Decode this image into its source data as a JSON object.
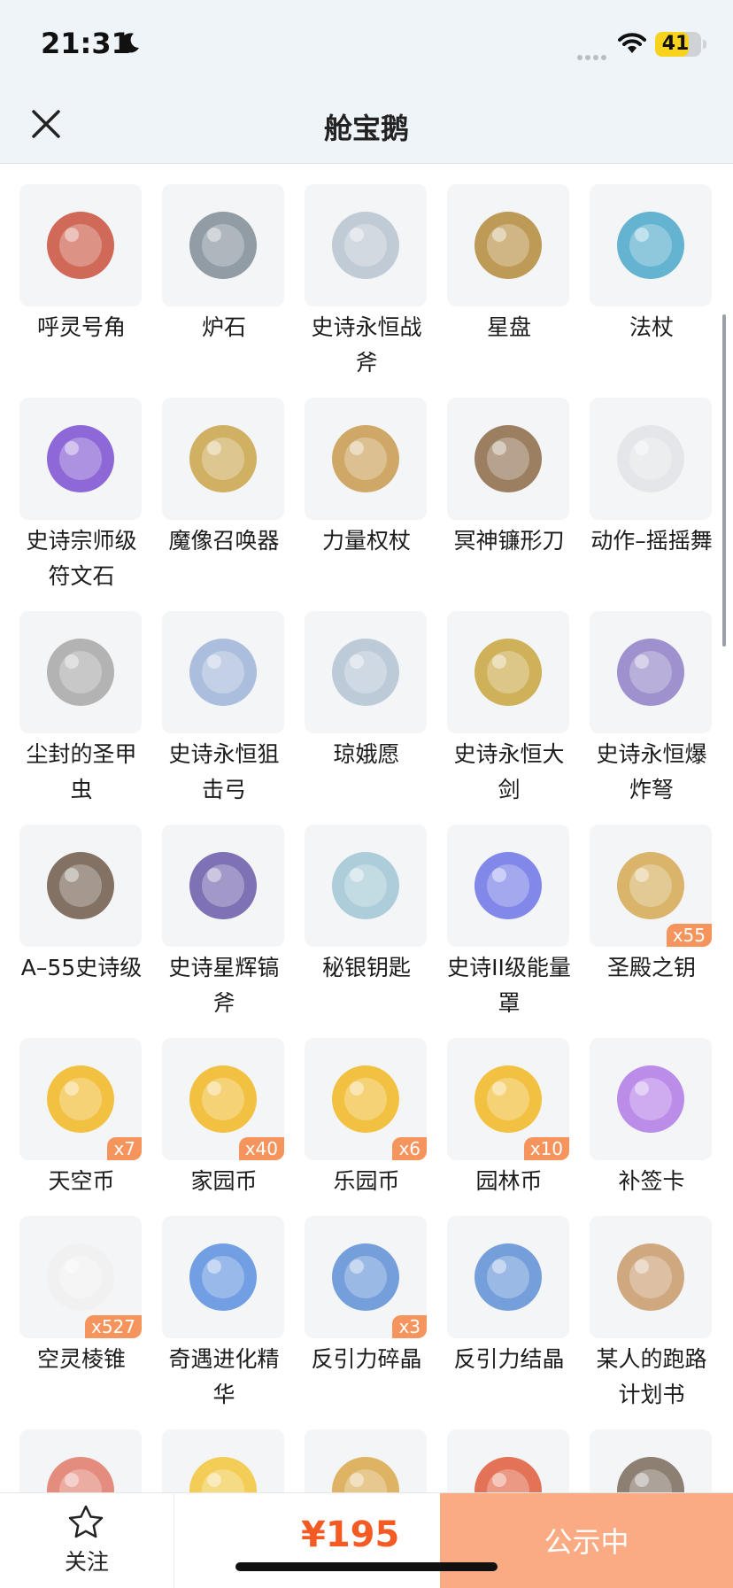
{
  "status_bar": {
    "time": "21:31",
    "battery": "41"
  },
  "header": {
    "title": "舱宝鹅"
  },
  "icons": {
    "close": "close-icon",
    "moon": "moon-icon",
    "wifi": "wifi-icon",
    "star": "star-icon"
  },
  "colors": {
    "accent": "#f45a24",
    "badge": "#f6945d",
    "action_button": "#fbab83",
    "header_bg": "#eef4f8",
    "tile_bg": "#f4f5f7"
  },
  "items": [
    {
      "label": "呼灵号角",
      "badge": ""
    },
    {
      "label": "炉石",
      "badge": ""
    },
    {
      "label": "史诗永恒战斧",
      "badge": ""
    },
    {
      "label": "星盘",
      "badge": ""
    },
    {
      "label": "法杖",
      "badge": ""
    },
    {
      "label": "史诗宗师级符文石",
      "badge": ""
    },
    {
      "label": "魔像召唤器",
      "badge": ""
    },
    {
      "label": "力量权杖",
      "badge": ""
    },
    {
      "label": "冥神镰形刀",
      "badge": ""
    },
    {
      "label": "动作–摇摇舞",
      "badge": ""
    },
    {
      "label": "尘封的圣甲虫",
      "badge": ""
    },
    {
      "label": "史诗永恒狙击弓",
      "badge": ""
    },
    {
      "label": "琼娥愿",
      "badge": ""
    },
    {
      "label": "史诗永恒大剑",
      "badge": ""
    },
    {
      "label": "史诗永恒爆炸弩",
      "badge": ""
    },
    {
      "label": "A–55史诗级",
      "badge": ""
    },
    {
      "label": "史诗星辉镐斧",
      "badge": ""
    },
    {
      "label": "秘银钥匙",
      "badge": ""
    },
    {
      "label": "史诗II级能量罩",
      "badge": ""
    },
    {
      "label": "圣殿之钥",
      "badge": "x55"
    },
    {
      "label": "天空币",
      "badge": "x7"
    },
    {
      "label": "家园币",
      "badge": "x40"
    },
    {
      "label": "乐园币",
      "badge": "x6"
    },
    {
      "label": "园林币",
      "badge": "x10"
    },
    {
      "label": "补签卡",
      "badge": ""
    },
    {
      "label": "空灵棱锥",
      "badge": "x527"
    },
    {
      "label": "奇遇进化精华",
      "badge": ""
    },
    {
      "label": "反引力碎晶",
      "badge": "x3"
    },
    {
      "label": "反引力结晶",
      "badge": ""
    },
    {
      "label": "某人的跑路计划书",
      "badge": ""
    },
    {
      "label": "",
      "badge": ""
    },
    {
      "label": "",
      "badge": ""
    },
    {
      "label": "",
      "badge": ""
    },
    {
      "label": "",
      "badge": ""
    },
    {
      "label": "",
      "badge": ""
    }
  ],
  "bottom_bar": {
    "follow_label": "关注",
    "price": "¥195",
    "status_label": "公示中"
  }
}
